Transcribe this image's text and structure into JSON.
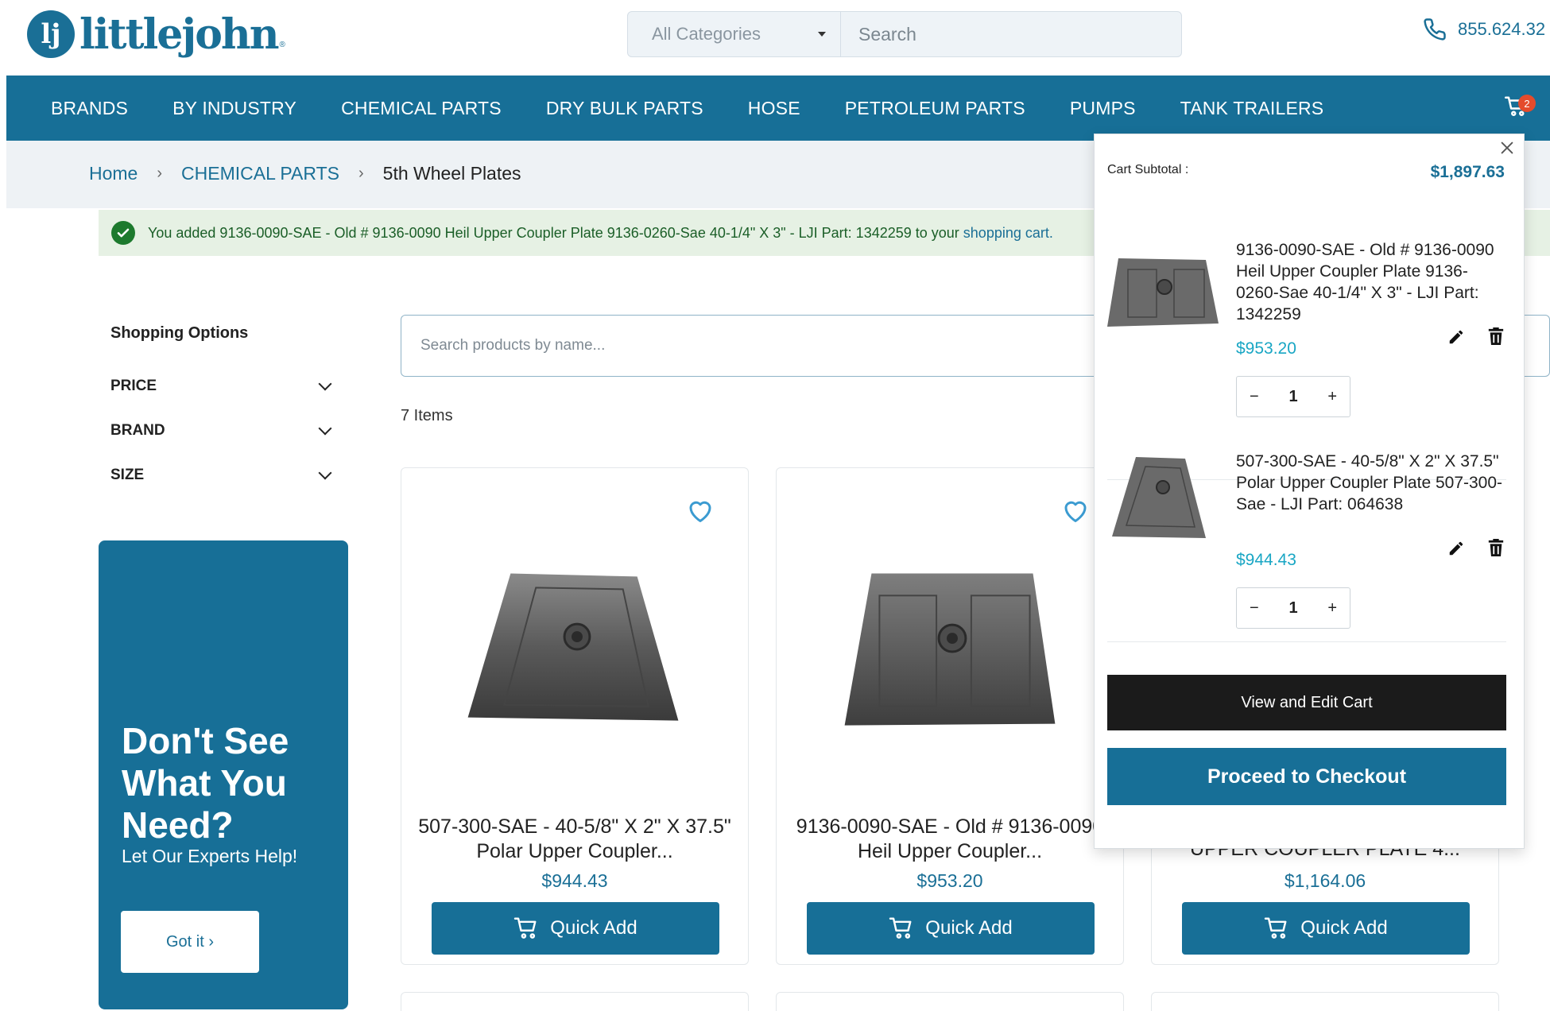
{
  "header": {
    "logo_mark": "lj",
    "logo_text": "littlejohn",
    "logo_reg": "®",
    "category_select": "All Categories",
    "search_placeholder": "Search",
    "phone": "855.624.32"
  },
  "nav": {
    "items": [
      "BRANDS",
      "BY INDUSTRY",
      "CHEMICAL PARTS",
      "DRY BULK PARTS",
      "HOSE",
      "PETROLEUM PARTS",
      "PUMPS",
      "TANK TRAILERS"
    ],
    "cart_count": "2"
  },
  "breadcrumb": {
    "home": "Home",
    "sep": "›",
    "category": "CHEMICAL PARTS",
    "current": "5th Wheel Plates"
  },
  "message": {
    "text": "You added 9136-0090-SAE - Old # 9136-0090 Heil Upper Coupler Plate 9136-0260-Sae 40-1/4\" X 3\" - LJI Part: 1342259 to your ",
    "link": "shopping cart."
  },
  "sidebar": {
    "title": "Shopping Options",
    "filters": [
      "PRICE",
      "BRAND",
      "SIZE"
    ],
    "promo_title": "Don't See What You Need?",
    "promo_sub": "Let Our Experts Help!",
    "promo_button": "Got it ›"
  },
  "main": {
    "search_placeholder": "Search products by name...",
    "items_count": "7 Items",
    "products": [
      {
        "title": "507-300-SAE - 40-5/8\" X 2\" X 37.5\" Polar Upper Coupler...",
        "price": "$944.43",
        "button": "Quick Add"
      },
      {
        "title": "9136-0090-SAE - Old # 9136-0090 Heil Upper Coupler...",
        "price": "$953.20",
        "button": "Quick Add"
      },
      {
        "title": "UPPER COUPLER PLATE 4...",
        "price": "$1,164.06",
        "button": "Quick Add"
      }
    ]
  },
  "mini_cart": {
    "subtotal_label": "Cart Subtotal :",
    "subtotal_value": "$1,897.63",
    "items": [
      {
        "name": "9136-0090-SAE - Old # 9136-0090 Heil Upper Coupler Plate 9136-0260-Sae 40-1/4\" X 3\" - LJI Part: 1342259",
        "price": "$953.20",
        "qty": "1"
      },
      {
        "name": "507-300-SAE - 40-5/8\" X 2\" X 37.5\" Polar Upper Coupler Plate 507-300-Sae - LJI Part: 064638",
        "price": "$944.43",
        "qty": "1"
      }
    ],
    "minus": "−",
    "plus": "+",
    "view_cart": "View and Edit Cart",
    "checkout": "Proceed to Checkout"
  },
  "colors": {
    "brand": "#176f97",
    "price_blue": "#1a6f96",
    "cart_price": "#19a6c4",
    "success_bg": "#e6f1e4",
    "badge": "#e44b2c"
  },
  "icons": [
    "phone-icon",
    "cart-icon",
    "check-icon",
    "heart-icon",
    "close-icon",
    "edit-icon",
    "trash-icon",
    "chevron-down-icon"
  ]
}
